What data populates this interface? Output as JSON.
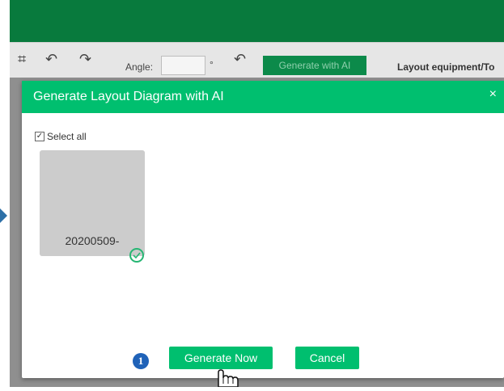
{
  "toolbar": {
    "icons": [
      "grid-tool-icon",
      "undo-icon",
      "redo-icon",
      "reset-icon"
    ],
    "angle_label": "Angle:",
    "angle_value": "",
    "degree_symbol": "°",
    "ai_button_label": "Generate with AI",
    "layout_label": "Layout equipment/To"
  },
  "modal": {
    "title": "Generate Layout Diagram with AI",
    "close_glyph": "×",
    "select_all_label": "Select all",
    "select_all_checked": true,
    "items": [
      {
        "label": "20200509-",
        "selected": true
      }
    ],
    "generate_label": "Generate Now",
    "cancel_label": "Cancel"
  },
  "annotation": {
    "step_number": "1"
  },
  "colors": {
    "header_bg": "#087a3d",
    "modal_header": "#00bf6f",
    "button_bg": "#00bf6f",
    "check_green": "#26b673",
    "badge_blue": "#1f62b8"
  }
}
